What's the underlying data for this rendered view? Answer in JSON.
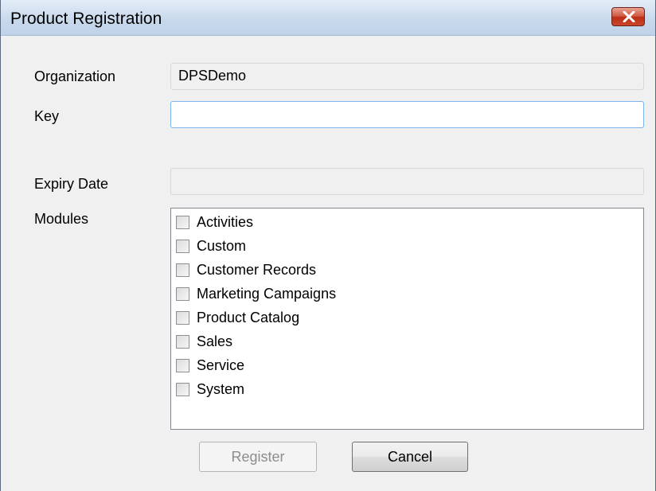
{
  "window": {
    "title": "Product Registration"
  },
  "form": {
    "organization_label": "Organization",
    "organization_value": "DPSDemo",
    "key_label": "Key",
    "key_value": "",
    "expiry_label": "Expiry Date",
    "expiry_value": "",
    "modules_label": "Modules"
  },
  "modules": [
    {
      "label": "Activities",
      "checked": false
    },
    {
      "label": "Custom",
      "checked": false
    },
    {
      "label": "Customer Records",
      "checked": false
    },
    {
      "label": "Marketing Campaigns",
      "checked": false
    },
    {
      "label": "Product Catalog",
      "checked": false
    },
    {
      "label": "Sales",
      "checked": false
    },
    {
      "label": "Service",
      "checked": false
    },
    {
      "label": "System",
      "checked": false
    }
  ],
  "buttons": {
    "register": "Register",
    "cancel": "Cancel"
  },
  "icons": {
    "close": "close-icon"
  },
  "colors": {
    "close_button": "#c8462c",
    "focus_border": "#7eb4ea"
  }
}
